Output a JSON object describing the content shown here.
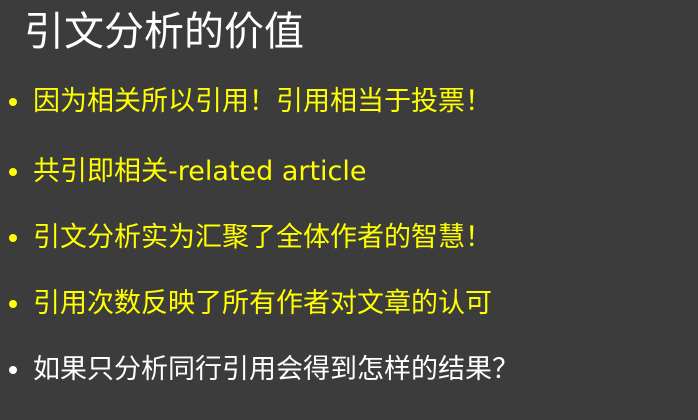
{
  "slide": {
    "title": "引文分析的价值",
    "colors": {
      "background": "#3c3c3c",
      "title": "#ffffff",
      "highlight": "#ffff00",
      "normal": "#ffffff"
    },
    "bullets": [
      {
        "text": "因为相关所以引用！引用相当于投票！",
        "color": "#ffff00"
      },
      {
        "text": "共引即相关-related article",
        "color": "#ffff00"
      },
      {
        "text": "引文分析实为汇聚了全体作者的智慧！",
        "color": "#ffff00"
      },
      {
        "text": "引用次数反映了所有作者对文章的认可",
        "color": "#ffff00"
      },
      {
        "text": "如果只分析同行引用会得到怎样的结果？",
        "color": "#ffffff"
      }
    ]
  }
}
